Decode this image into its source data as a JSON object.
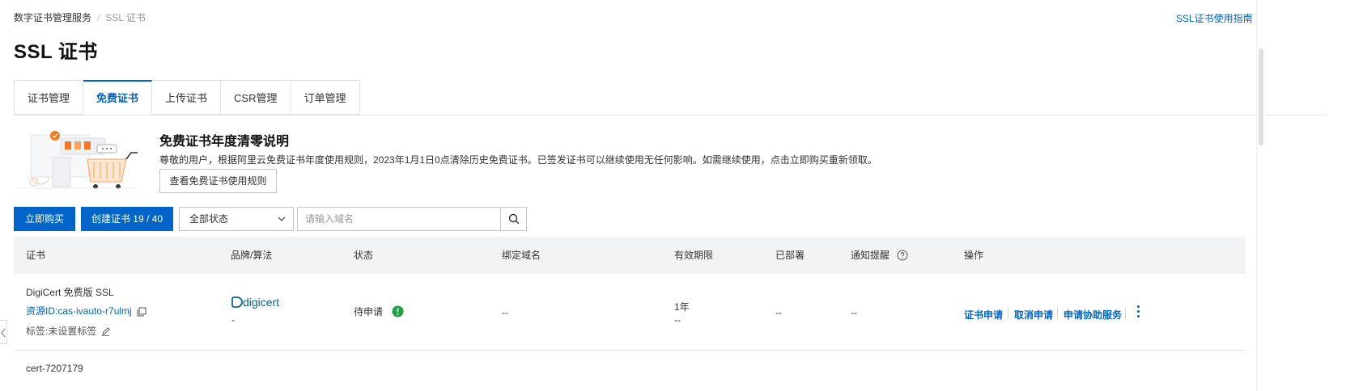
{
  "breadcrumb": {
    "root": "数字证书管理服务",
    "separator": "/",
    "current": "SSL 证书"
  },
  "header": {
    "guide_link": "SSL证书使用指南",
    "title": "SSL 证书"
  },
  "tabs": [
    {
      "label": "证书管理",
      "active": false
    },
    {
      "label": "免费证书",
      "active": true
    },
    {
      "label": "上传证书",
      "active": false
    },
    {
      "label": "CSR管理",
      "active": false
    },
    {
      "label": "订单管理",
      "active": false
    }
  ],
  "notice": {
    "title": "免费证书年度清零说明",
    "text": "尊敬的用户，根据阿里云免费证书年度使用规则，2023年1月1日0点清除历史免费证书。已签发证书可以继续使用无任何影响。如需继续使用，点击立即购买重新领取。",
    "button": "查看免费证书使用规则"
  },
  "toolbar": {
    "buy_label": "立即购买",
    "create_label": "创建证书 19 / 40",
    "status_selected": "全部状态",
    "search_placeholder": "请输入域名"
  },
  "table": {
    "columns": [
      "证书",
      "品牌/算法",
      "状态",
      "绑定域名",
      "有效期限",
      "已部署",
      "通知提醒",
      "操作"
    ],
    "rows": [
      {
        "name": "DigiCert 免费版 SSL",
        "resource_id": "资源ID:cas-ivauto-r7ulmj",
        "tag": "标签:未设置标签",
        "brand": "digicert",
        "algorithm": "-",
        "status": "待申请",
        "domain": "--",
        "validity": "1年",
        "validity_sub": "--",
        "deployed": "--",
        "notify": "--",
        "actions": [
          "证书申请",
          "取消申请",
          "申请协助服务"
        ]
      },
      {
        "name": "cert-7207179"
      }
    ]
  },
  "colors": {
    "accent": "#0064c8",
    "success": "#1aa33f",
    "header_bg": "#f2f3f5"
  }
}
